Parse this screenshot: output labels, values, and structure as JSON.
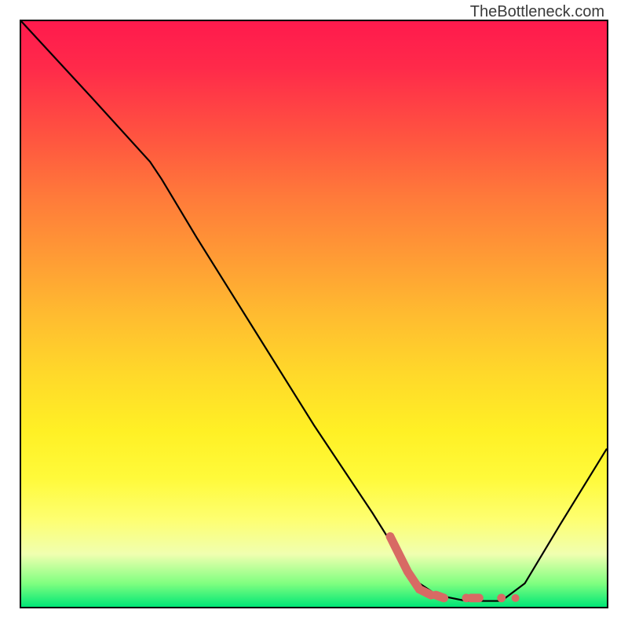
{
  "watermark": "TheBottleneck.com",
  "chart_data": {
    "type": "line",
    "title": "",
    "xlabel": "",
    "ylabel": "",
    "xlim": [
      0,
      100
    ],
    "ylim": [
      0,
      100
    ],
    "gradient_stops": [
      {
        "pos": 0,
        "color": "#ff1a4d"
      },
      {
        "pos": 20,
        "color": "#ff5540"
      },
      {
        "pos": 40,
        "color": "#ff9a35"
      },
      {
        "pos": 60,
        "color": "#ffd82a"
      },
      {
        "pos": 80,
        "color": "#feff50"
      },
      {
        "pos": 96,
        "color": "#80ff80"
      },
      {
        "pos": 100,
        "color": "#00e676"
      }
    ],
    "series": [
      {
        "name": "bottleneck-curve",
        "style": "solid-black",
        "points": [
          {
            "x": 0,
            "y": 100
          },
          {
            "x": 12,
            "y": 87
          },
          {
            "x": 22,
            "y": 76
          },
          {
            "x": 24,
            "y": 73
          },
          {
            "x": 30,
            "y": 63
          },
          {
            "x": 40,
            "y": 47
          },
          {
            "x": 50,
            "y": 31
          },
          {
            "x": 60,
            "y": 16
          },
          {
            "x": 65,
            "y": 8
          },
          {
            "x": 68,
            "y": 4
          },
          {
            "x": 71,
            "y": 2
          },
          {
            "x": 76,
            "y": 1
          },
          {
            "x": 82,
            "y": 1
          },
          {
            "x": 86,
            "y": 4
          },
          {
            "x": 92,
            "y": 14
          },
          {
            "x": 100,
            "y": 27
          }
        ]
      },
      {
        "name": "highlight-segment",
        "style": "thick-salmon-dotted",
        "points": [
          {
            "x": 63,
            "y": 12
          },
          {
            "x": 66,
            "y": 6
          },
          {
            "x": 68,
            "y": 3
          },
          {
            "x": 70,
            "y": 2
          },
          {
            "x": 73,
            "y": 1.5
          },
          {
            "x": 76,
            "y": 1.5
          },
          {
            "x": 79,
            "y": 1.5
          },
          {
            "x": 82,
            "y": 1.5
          }
        ]
      }
    ]
  }
}
